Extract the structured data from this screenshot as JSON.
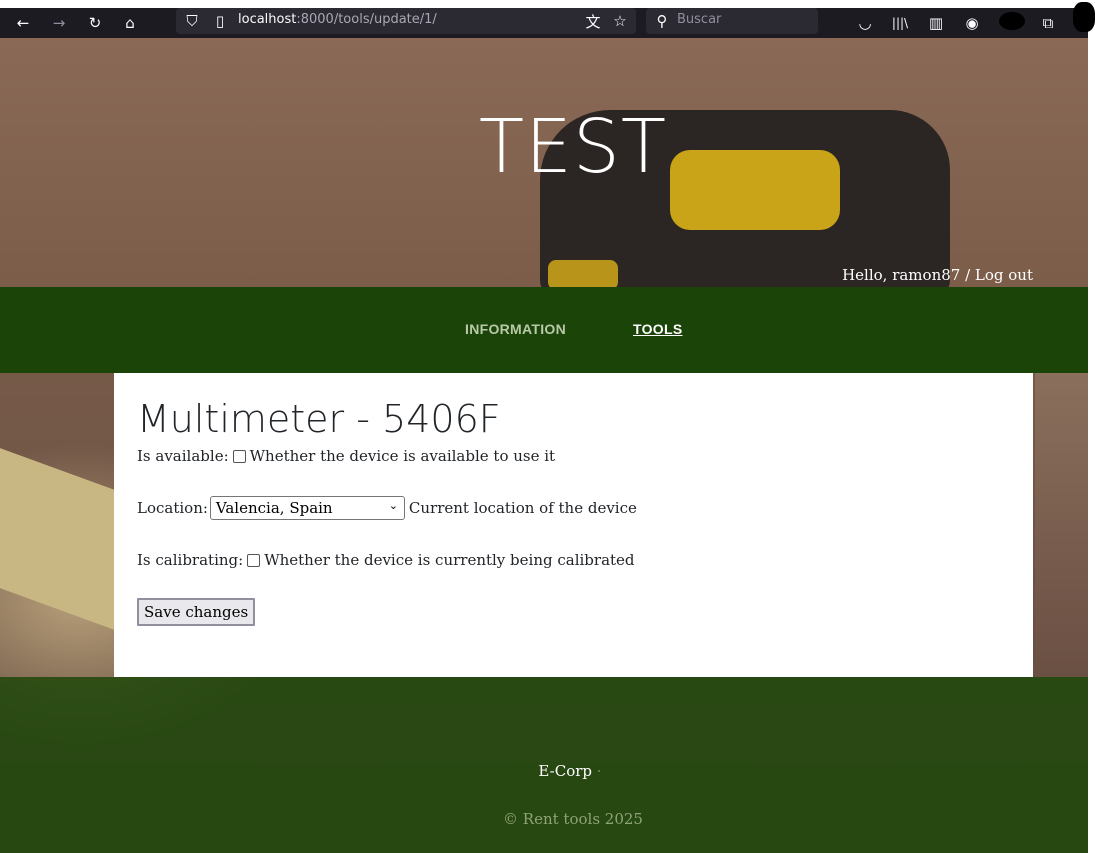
{
  "browser": {
    "url_host": "localhost",
    "url_rest": ":8000/tools/update/1/",
    "search_placeholder": "Buscar",
    "icons": {
      "back": "←",
      "forward": "→",
      "reload": "↻",
      "home": "⌂",
      "shield": "⛉",
      "page": "▯",
      "translate": "文",
      "star": "☆",
      "search": "⚲",
      "pocket": "◡",
      "library": "|||\\",
      "reader": "▥",
      "account": "◉",
      "extensions": "⧉"
    }
  },
  "header": {
    "site_title": "TEST",
    "greeting": "Hello, ramon87 / ",
    "logout_label": "Log out"
  },
  "nav": {
    "items": [
      {
        "label": "INFORMATION"
      },
      {
        "label": "TOOLS"
      }
    ]
  },
  "form": {
    "title": "Multimeter - 5406F",
    "available_label": "Is available:",
    "available_help": "Whether the device is available to use it",
    "location_label": "Location:",
    "location_value": "Valencia, Spain",
    "location_help": "Current location of the device",
    "calibrating_label": "Is calibrating:",
    "calibrating_help": "Whether the device is currently being calibrated",
    "save_label": "Save changes"
  },
  "footer": {
    "brand": "E-Corp",
    "separator": "·",
    "copyright": "© Rent tools 2025"
  },
  "colors": {
    "nav_bg": "#1b4508",
    "footer_bg": "#1f480a",
    "toolbar_bg": "#1c1b22"
  }
}
